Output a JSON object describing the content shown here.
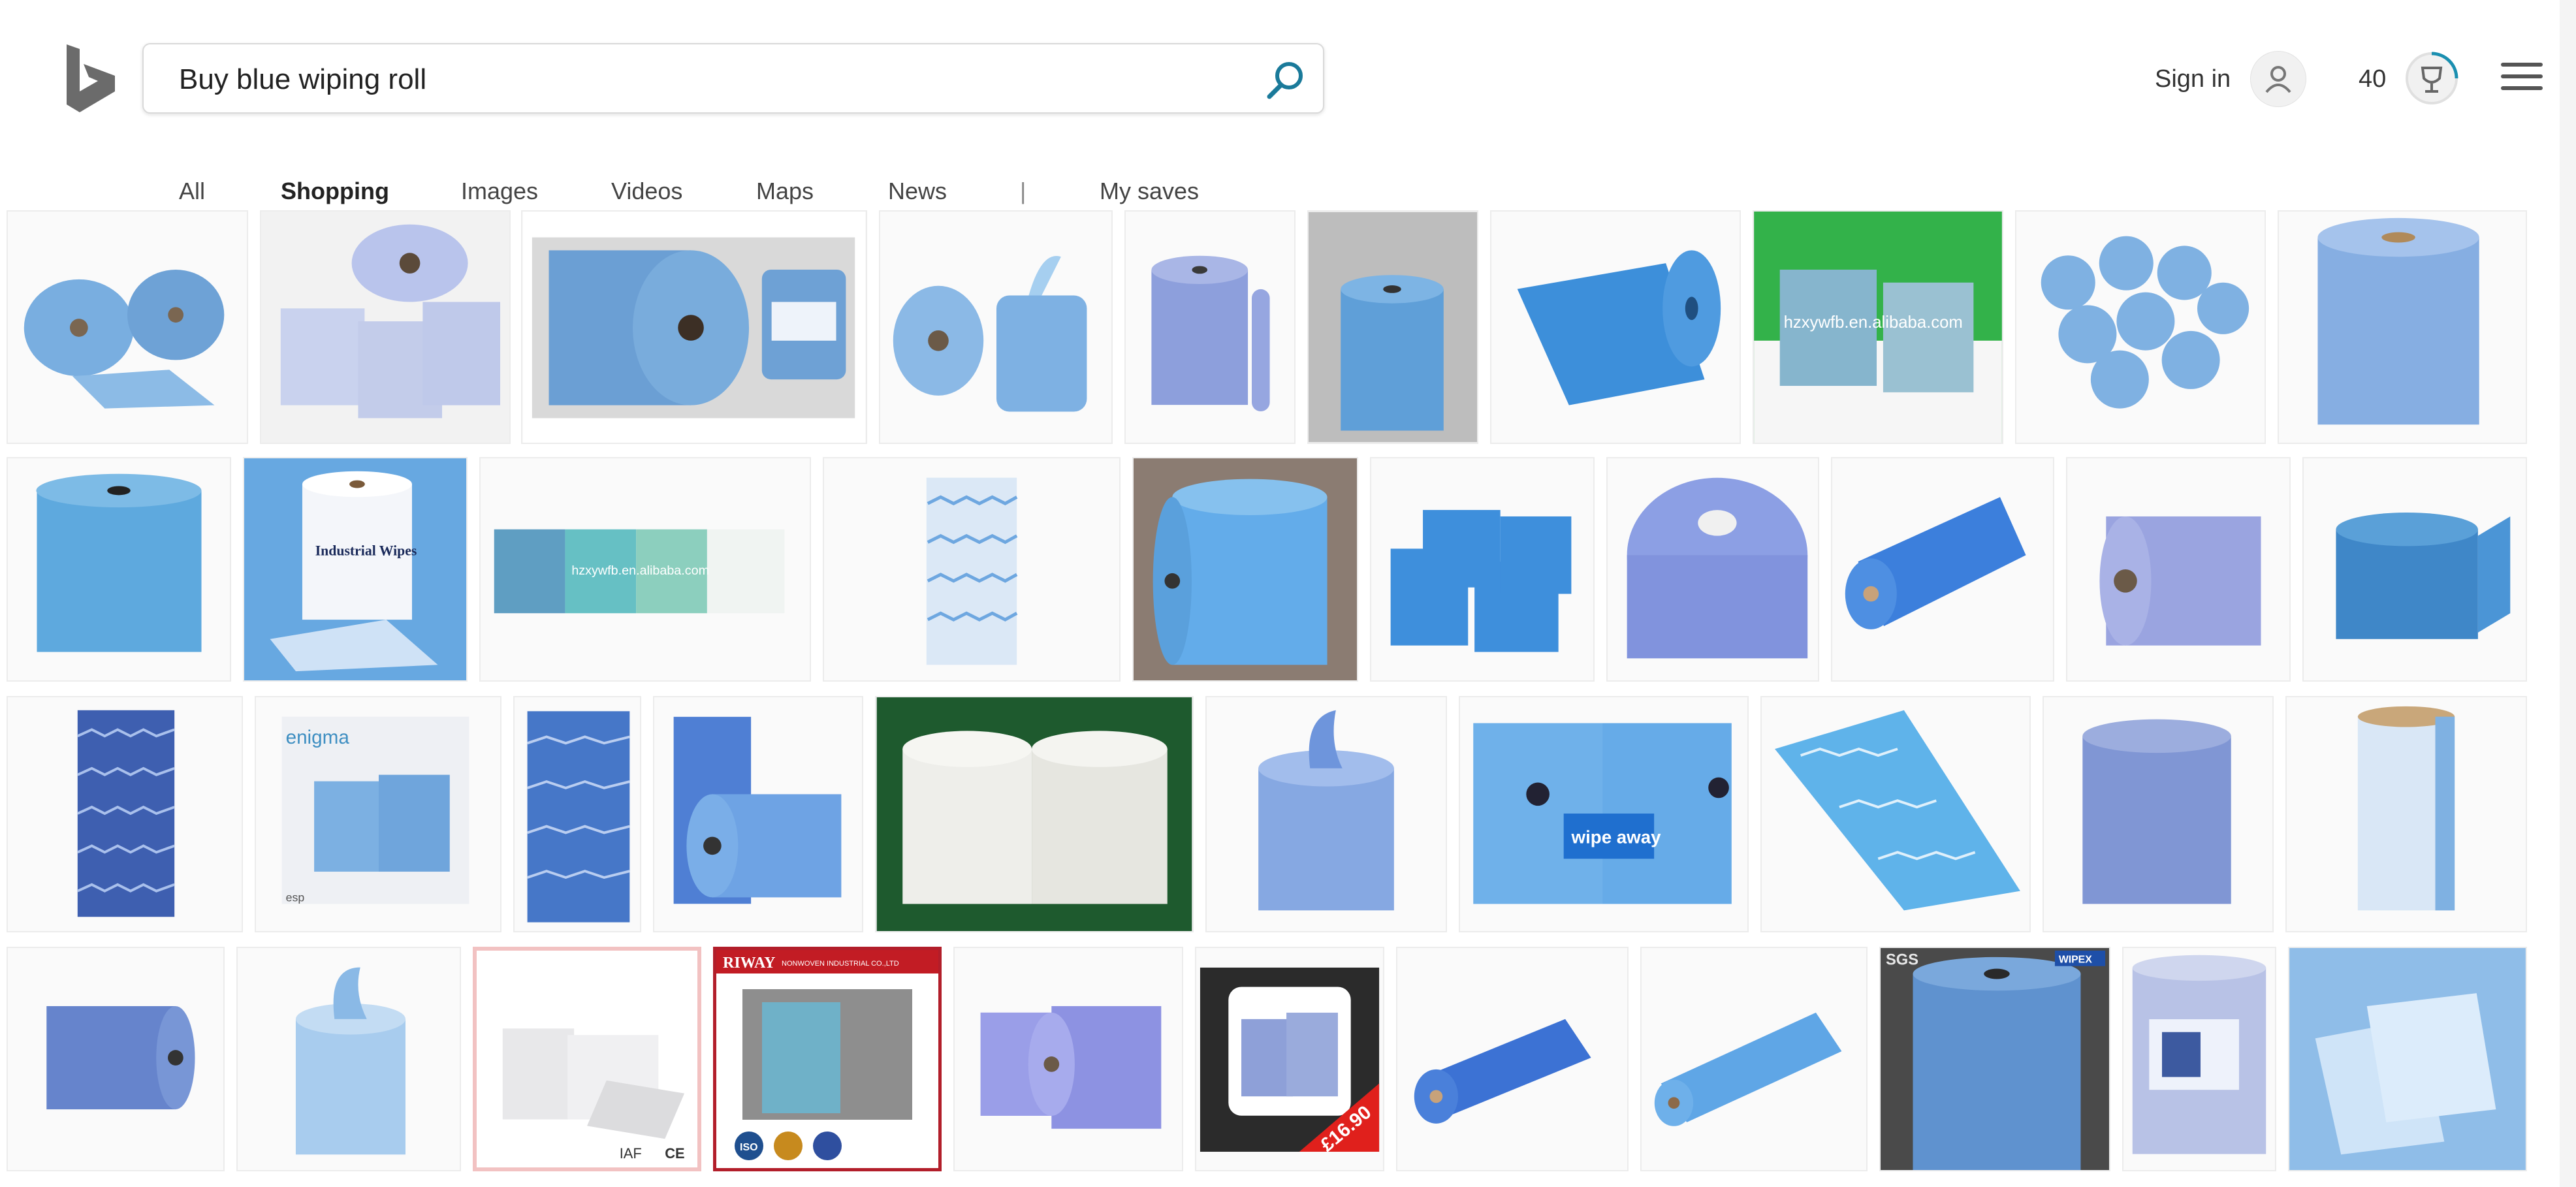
{
  "search": {
    "query": "Buy blue wiping roll"
  },
  "header": {
    "signin_label": "Sign in",
    "rewards_points": "40"
  },
  "tabs": [
    {
      "label": "All"
    },
    {
      "label": "Shopping"
    },
    {
      "label": "Images"
    },
    {
      "label": "Videos"
    },
    {
      "label": "Maps"
    },
    {
      "label": "News"
    },
    {
      "label": "|"
    },
    {
      "label": "My saves"
    }
  ],
  "overlays": {
    "watermark1": "hzxywfb.en.alibaba.com",
    "watermark2": "hzxywfb.en.alibaba.com",
    "industrial_wipes": "Industrial Wipes",
    "enigma": "enigma",
    "esp": "esp",
    "wipe_away": "wipe away",
    "riway": "RIWAY",
    "riway_sub": "NONWOVEN INDUSTRIAL CO.,LTD",
    "price": "£16.90",
    "sgs": "SGS",
    "wipex": "WIPEX",
    "iso": "ISO",
    "iaf": "IAF",
    "ce": "CE"
  },
  "colors": {
    "accent": "#174ae4",
    "search_icon": "#1a7a9a",
    "roll_blue": "#6fa5d8",
    "roll_blue_dark": "#4a84c4",
    "green_bg": "#33b24a",
    "dark_green_bg": "#1e5a2e"
  }
}
